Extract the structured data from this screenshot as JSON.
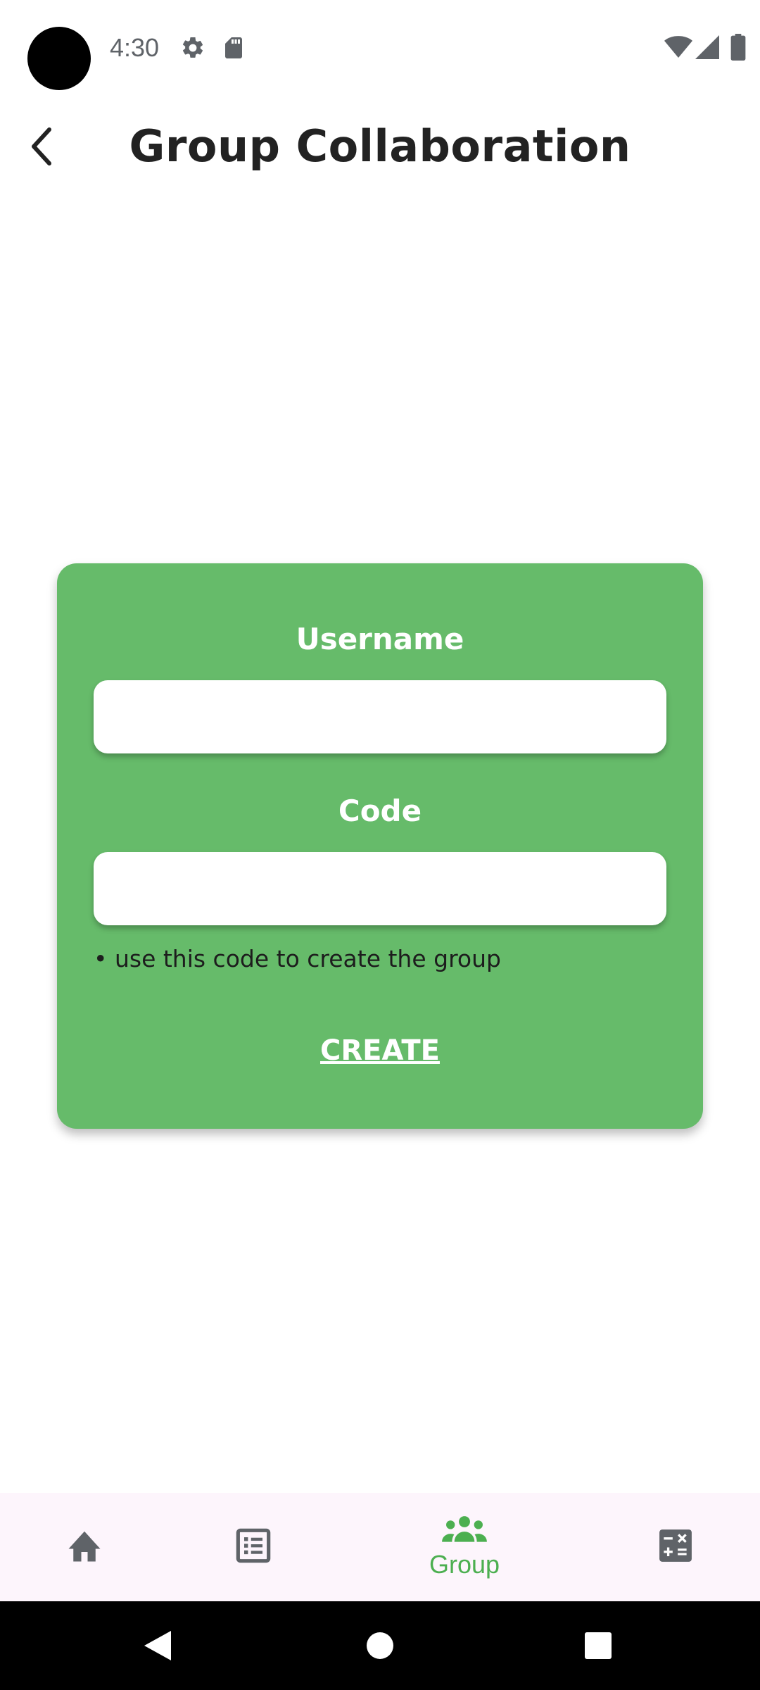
{
  "status_bar": {
    "time": "4:30",
    "icons": [
      "settings-icon",
      "sd-card-icon",
      "wifi-icon",
      "signal-icon",
      "battery-icon"
    ]
  },
  "header": {
    "title": "Group Collaboration",
    "back_icon": "chevron-left-icon"
  },
  "form": {
    "username_label": "Username",
    "username_value": "",
    "code_label": "Code",
    "code_value": "",
    "hint": "• use this code to create the group",
    "create_label": "CREATE"
  },
  "bottom_nav": {
    "items": [
      {
        "icon": "home-icon",
        "label": "",
        "active": false
      },
      {
        "icon": "list-icon",
        "label": "",
        "active": false
      },
      {
        "icon": "group-icon",
        "label": "Group",
        "active": true
      },
      {
        "icon": "calculator-icon",
        "label": "",
        "active": false
      }
    ]
  },
  "colors": {
    "card": "#66bb6a",
    "accent": "#4caf50",
    "nav_background": "#fdf5fc",
    "icon_gray": "#5f6368"
  }
}
